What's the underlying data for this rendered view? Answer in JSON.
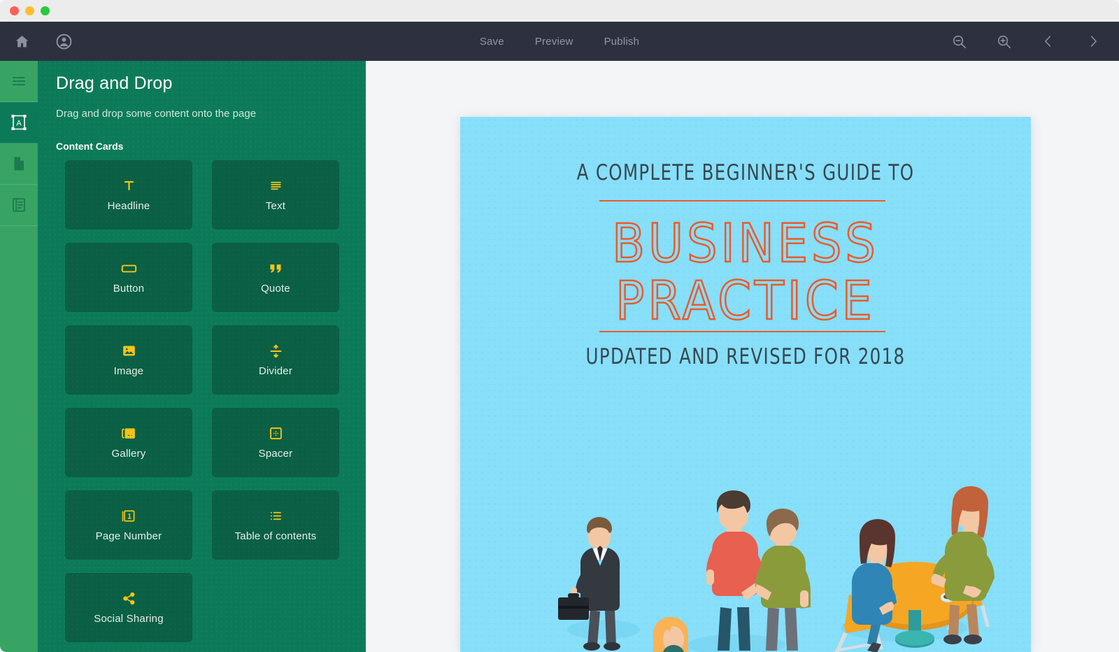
{
  "window": {
    "traffic_lights": [
      {
        "name": "close",
        "color": "#ff5f56"
      },
      {
        "name": "minimize",
        "color": "#ffbd2e"
      },
      {
        "name": "zoom",
        "color": "#27c93f"
      }
    ]
  },
  "toolbar": {
    "background": "#2d313f",
    "home_icon": "home-icon",
    "account_icon": "account-icon",
    "links": [
      {
        "label": "Save",
        "name": "save-link"
      },
      {
        "label": "Preview",
        "name": "preview-link"
      },
      {
        "label": "Publish",
        "name": "publish-link"
      }
    ],
    "actions": [
      {
        "name": "zoom-out-icon"
      },
      {
        "name": "zoom-in-icon"
      },
      {
        "name": "previous-page-icon"
      },
      {
        "name": "next-page-icon"
      }
    ]
  },
  "rail": {
    "background": "#37a464",
    "active_background": "#0c7a58",
    "items": [
      {
        "name": "sidebar-item-outline",
        "icon": "list-lines-icon",
        "active": false
      },
      {
        "name": "sidebar-item-content",
        "icon": "text-frame-icon",
        "active": true
      },
      {
        "name": "sidebar-item-pages",
        "icon": "document-icon",
        "active": false
      },
      {
        "name": "sidebar-item-library",
        "icon": "book-icon",
        "active": false
      }
    ]
  },
  "panel": {
    "background": "#0c7a58",
    "title": "Drag and Drop",
    "subtitle": "Drag and drop some content onto the page",
    "section_label": "Content Cards",
    "card_background": "#0a5f44",
    "card_icon_color": "#f5c518",
    "cards": [
      {
        "label": "Headline",
        "icon": "headline-t-icon",
        "name": "content-card-headline"
      },
      {
        "label": "Text",
        "icon": "text-lines-icon",
        "name": "content-card-text"
      },
      {
        "label": "Button",
        "icon": "button-rect-icon",
        "name": "content-card-button"
      },
      {
        "label": "Quote",
        "icon": "quote-marks-icon",
        "name": "content-card-quote"
      },
      {
        "label": "Image",
        "icon": "image-icon",
        "name": "content-card-image"
      },
      {
        "label": "Divider",
        "icon": "divider-icon",
        "name": "content-card-divider"
      },
      {
        "label": "Gallery",
        "icon": "gallery-icon",
        "name": "content-card-gallery"
      },
      {
        "label": "Spacer",
        "icon": "spacer-icon",
        "name": "content-card-spacer"
      },
      {
        "label": "Page Number",
        "icon": "page-number-icon",
        "name": "content-card-page-number"
      },
      {
        "label": "Table of contents",
        "icon": "table-of-contents-icon",
        "name": "content-card-table-of-contents"
      },
      {
        "label": "Social Sharing",
        "icon": "share-icon",
        "name": "content-card-social-sharing"
      }
    ]
  },
  "canvas": {
    "workspace_background": "#f4f5f7",
    "page": {
      "background": "#87dffa",
      "accent_color": "#ed5a2b",
      "text_color": "#37474f",
      "eyebrow": "A COMPLETE BEGINNER'S GUIDE TO",
      "title": "BUSINESS\nPRACTICE",
      "footer": "UPDATED AND REVISED FOR 2018",
      "illustration": "business-people-isometric-illustration"
    }
  }
}
